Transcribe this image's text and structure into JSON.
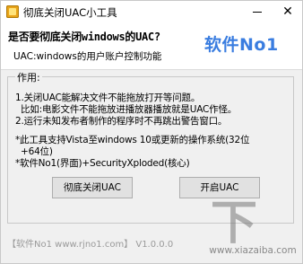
{
  "window": {
    "title": "彻底关闭UAC小工具",
    "close_glyph": "✕"
  },
  "header": {
    "question": "是否要彻底关闭windows的UAC?",
    "subtitle": "UAC:windows的用户账户控制功能",
    "brand": "软件No1"
  },
  "group": {
    "legend": "作用:",
    "lines": [
      "1.关闭UAC能解决文件不能拖放打开等问题。",
      "比如:电影文件不能拖放进播放器播放就是UAC作怪。",
      "2.运行未知发布者制作的程序时不再跳出警告窗口。",
      "*此工具支持Vista至windows 10或更新的操作系统(32位",
      "+64位)",
      "*软件No1(界面)+SecurityXploded(核心)"
    ]
  },
  "buttons": {
    "disable_uac": "彻底关闭UAC",
    "enable_uac": "开启UAC"
  },
  "footer": {
    "text": "【软件No1 www.rjno1.com】 V1.0.0.0"
  },
  "watermark": {
    "mark": "下",
    "text": "www.xiazaiba.com"
  }
}
